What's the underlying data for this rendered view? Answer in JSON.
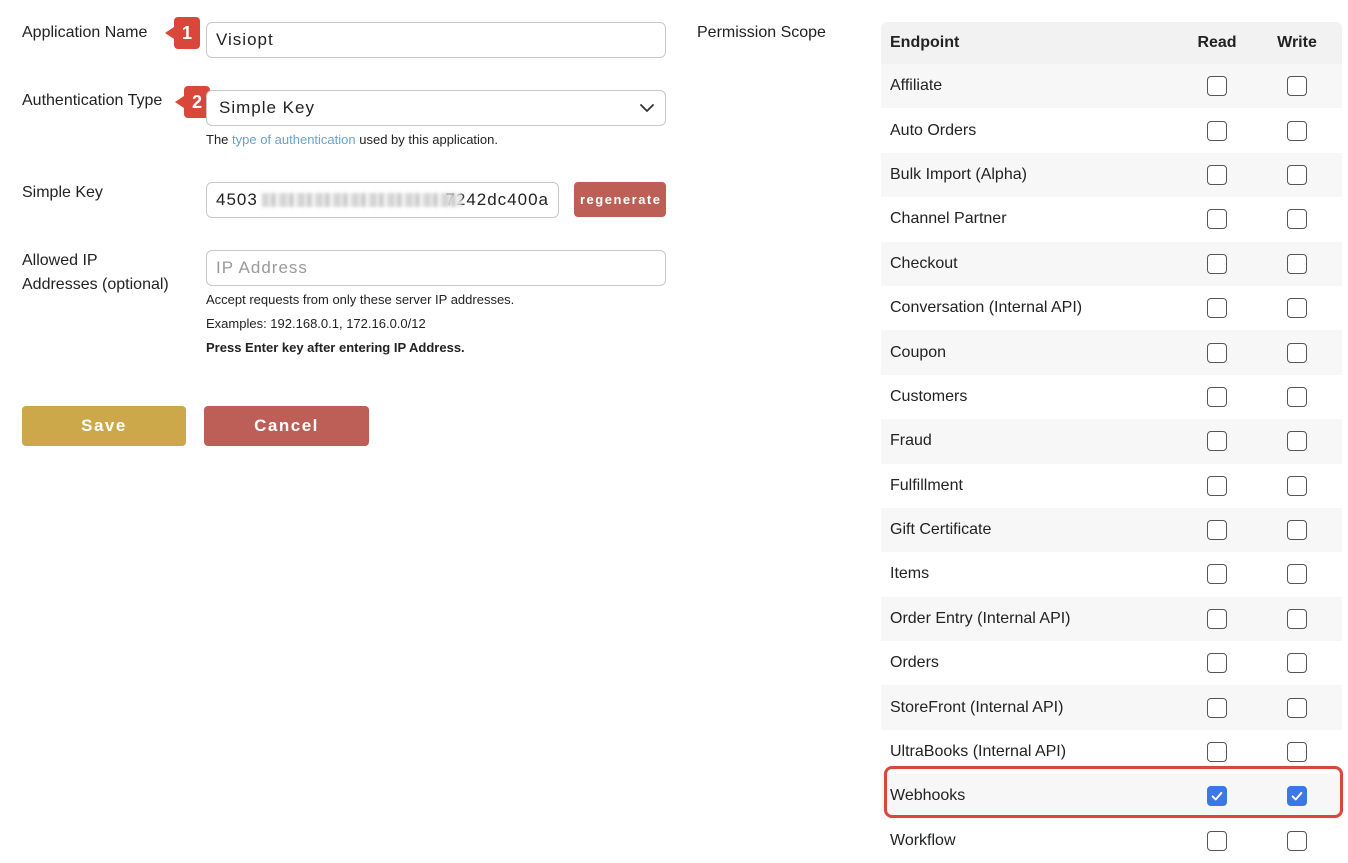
{
  "form": {
    "app_name_label": "Application Name",
    "app_name_value": "Visiopt",
    "auth_type_label": "Authentication Type",
    "auth_type_value": "Simple Key",
    "auth_help_prefix": "The",
    "auth_help_link": "type of authentication",
    "auth_help_suffix": "used by this application.",
    "simple_key_label": "Simple Key",
    "simple_key_prefix": "4503",
    "simple_key_suffix": "7242dc400a",
    "regenerate_label": "regenerate",
    "ip_label_line1": "Allowed IP",
    "ip_label_line2": "Addresses (optional)",
    "ip_placeholder": "IP Address",
    "ip_help_1": "Accept requests from only these server IP addresses.",
    "ip_help_2": "Examples: 192.168.0.1, 172.16.0.0/12",
    "ip_help_3": "Press Enter key after entering IP Address.",
    "save_label": "Save",
    "cancel_label": "Cancel"
  },
  "annotations": {
    "badge_1": "1",
    "badge_2": "2"
  },
  "permissions": {
    "section_label": "Permission Scope",
    "headers": {
      "endpoint": "Endpoint",
      "read": "Read",
      "write": "Write"
    },
    "rows": [
      {
        "name": "Affiliate",
        "read": false,
        "write": false
      },
      {
        "name": "Auto Orders",
        "read": false,
        "write": false
      },
      {
        "name": "Bulk Import (Alpha)",
        "read": false,
        "write": false
      },
      {
        "name": "Channel Partner",
        "read": false,
        "write": false
      },
      {
        "name": "Checkout",
        "read": false,
        "write": false
      },
      {
        "name": "Conversation (Internal API)",
        "read": false,
        "write": false
      },
      {
        "name": "Coupon",
        "read": false,
        "write": false
      },
      {
        "name": "Customers",
        "read": false,
        "write": false
      },
      {
        "name": "Fraud",
        "read": false,
        "write": false
      },
      {
        "name": "Fulfillment",
        "read": false,
        "write": false
      },
      {
        "name": "Gift Certificate",
        "read": false,
        "write": false
      },
      {
        "name": "Items",
        "read": false,
        "write": false
      },
      {
        "name": "Order Entry (Internal API)",
        "read": false,
        "write": false
      },
      {
        "name": "Orders",
        "read": false,
        "write": false
      },
      {
        "name": "StoreFront (Internal API)",
        "read": false,
        "write": false
      },
      {
        "name": "UltraBooks (Internal API)",
        "read": false,
        "write": false
      },
      {
        "name": "Webhooks",
        "read": true,
        "write": true
      },
      {
        "name": "Workflow",
        "read": false,
        "write": false
      }
    ]
  },
  "colors": {
    "save_button": "#cda84b",
    "cancel_button": "#bd5f56",
    "regenerate_button": "#bd5f56",
    "annotation_red": "#d9473a",
    "checkbox_checked": "#3b77e6",
    "link": "#6aa2c8"
  }
}
